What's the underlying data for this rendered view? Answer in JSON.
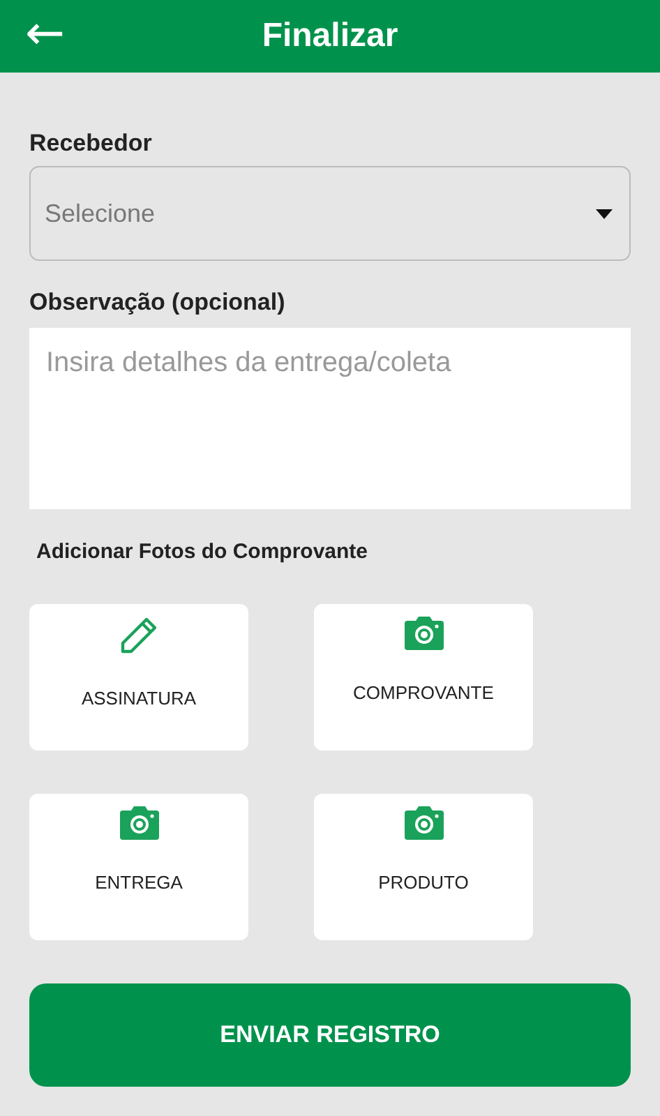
{
  "header": {
    "back": "←",
    "title": "Finalizar"
  },
  "receiver": {
    "label": "Recebedor",
    "placeholder": "Selecione"
  },
  "note": {
    "label": "Observação (opcional)",
    "placeholder": "Insira detalhes da entrega/coleta"
  },
  "photos": {
    "title": "Adicionar Fotos do Comprovante",
    "tiles": [
      {
        "kind": "signature",
        "label": "ASSINATURA"
      },
      {
        "kind": "camera",
        "label": "COMPROVANTE"
      },
      {
        "kind": "camera",
        "label": "ENTREGA"
      },
      {
        "kind": "camera",
        "label": "PRODUTO"
      }
    ]
  },
  "submit": "ENVIAR REGISTRO"
}
